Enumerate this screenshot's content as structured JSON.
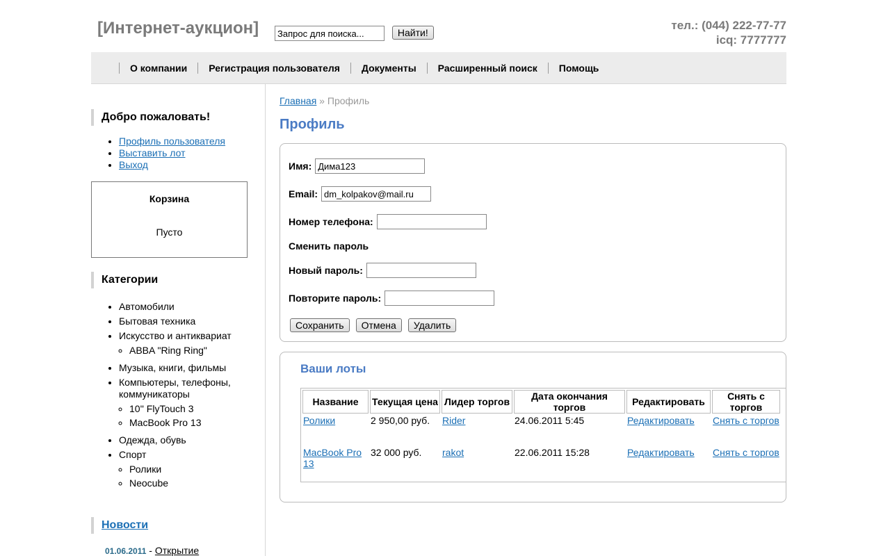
{
  "header": {
    "logo": "[Интернет-аукцион]",
    "search_placeholder": "Запрос для поиска...",
    "search_button": "Найти!",
    "phone": "тел.: (044) 222-77-77",
    "icq": "icq: 7777777"
  },
  "nav": [
    "О компании",
    "Регистрация пользователя",
    "Документы",
    "Расширенный поиск",
    "Помощь"
  ],
  "sidebar": {
    "welcome": "Добро пожаловать!",
    "links": [
      "Профиль пользователя",
      "Выставить лот",
      "Выход"
    ],
    "cart_title": "Корзина",
    "cart_empty": "Пусто",
    "categories_title": "Категории",
    "categories": [
      {
        "name": "Автомобили",
        "sub": []
      },
      {
        "name": "Бытовая техника",
        "sub": []
      },
      {
        "name": "Искусство и антиквариат",
        "sub": [
          "ABBA \"Ring Ring\""
        ]
      },
      {
        "name": "Музыка, книги, фильмы",
        "sub": []
      },
      {
        "name": "Компьютеры, телефоны, коммуникаторы",
        "sub": [
          "10'' FlyTouch 3",
          "MacBook Pro 13"
        ]
      },
      {
        "name": "Одежда, обувь",
        "sub": []
      },
      {
        "name": "Спорт",
        "sub": [
          "Ролики",
          "Neocube"
        ]
      }
    ],
    "news_title": "Новости",
    "news_date": "01.06.2011",
    "news_sep": " - ",
    "news_text": "Открытие"
  },
  "main": {
    "breadcrumb_home": "Главная",
    "breadcrumb_sep": " » ",
    "breadcrumb_current": "Профиль",
    "title": "Профиль",
    "form": {
      "name_label": "Имя:",
      "name_value": "Дима123",
      "email_label": "Email:",
      "email_value": "dm_kolpakov@mail.ru",
      "phone_label": "Номер телефона:",
      "phone_value": "",
      "change_pw": "Сменить пароль",
      "new_pw_label": "Новый пароль:",
      "repeat_pw_label": "Повторите пароль:",
      "save": "Сохранить",
      "cancel": "Отмена",
      "delete": "Удалить"
    },
    "lots": {
      "title": "Ваши лоты",
      "columns": [
        "Название",
        "Текущая цена",
        "Лидер торгов",
        "Дата окончания торгов",
        "Редактировать",
        "Снять с торгов"
      ],
      "rows": [
        {
          "name": "Ролики",
          "price": "2 950,00 руб.",
          "leader": "Rider",
          "date": "24.06.2011 5:45",
          "edit": "Редактировать",
          "remove": "Снять с торгов"
        },
        {
          "name": "MacBook Pro 13",
          "price": "32 000 руб.",
          "leader": "rakot",
          "date": "22.06.2011 15:28",
          "edit": "Редактировать",
          "remove": "Снять с торгов"
        }
      ]
    }
  }
}
